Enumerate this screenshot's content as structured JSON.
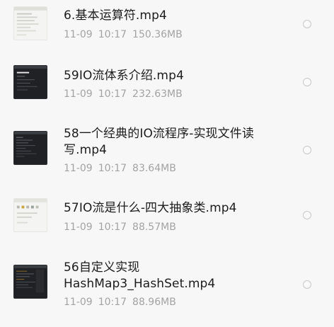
{
  "files": [
    {
      "name": "6.基本运算符.mp4",
      "date": "11-09",
      "time": "10:17",
      "size": "150.36MB",
      "thumbnail": "light"
    },
    {
      "name": "59IO流体系介绍.mp4",
      "date": "11-09",
      "time": "10:17",
      "size": "232.63MB",
      "thumbnail": "dark"
    },
    {
      "name": "58一个经典的IO流程序-实现文件读写.mp4",
      "date": "11-09",
      "time": "10:17",
      "size": "83.64MB",
      "thumbnail": "dark"
    },
    {
      "name": "57IO流是什么-四大抽象类.mp4",
      "date": "11-09",
      "time": "10:17",
      "size": "88.57MB",
      "thumbnail": "light"
    },
    {
      "name": "56自定义实现HashMap3_HashSet.mp4",
      "date": "11-09",
      "time": "10:17",
      "size": "88.96MB",
      "thumbnail": "dark"
    }
  ]
}
